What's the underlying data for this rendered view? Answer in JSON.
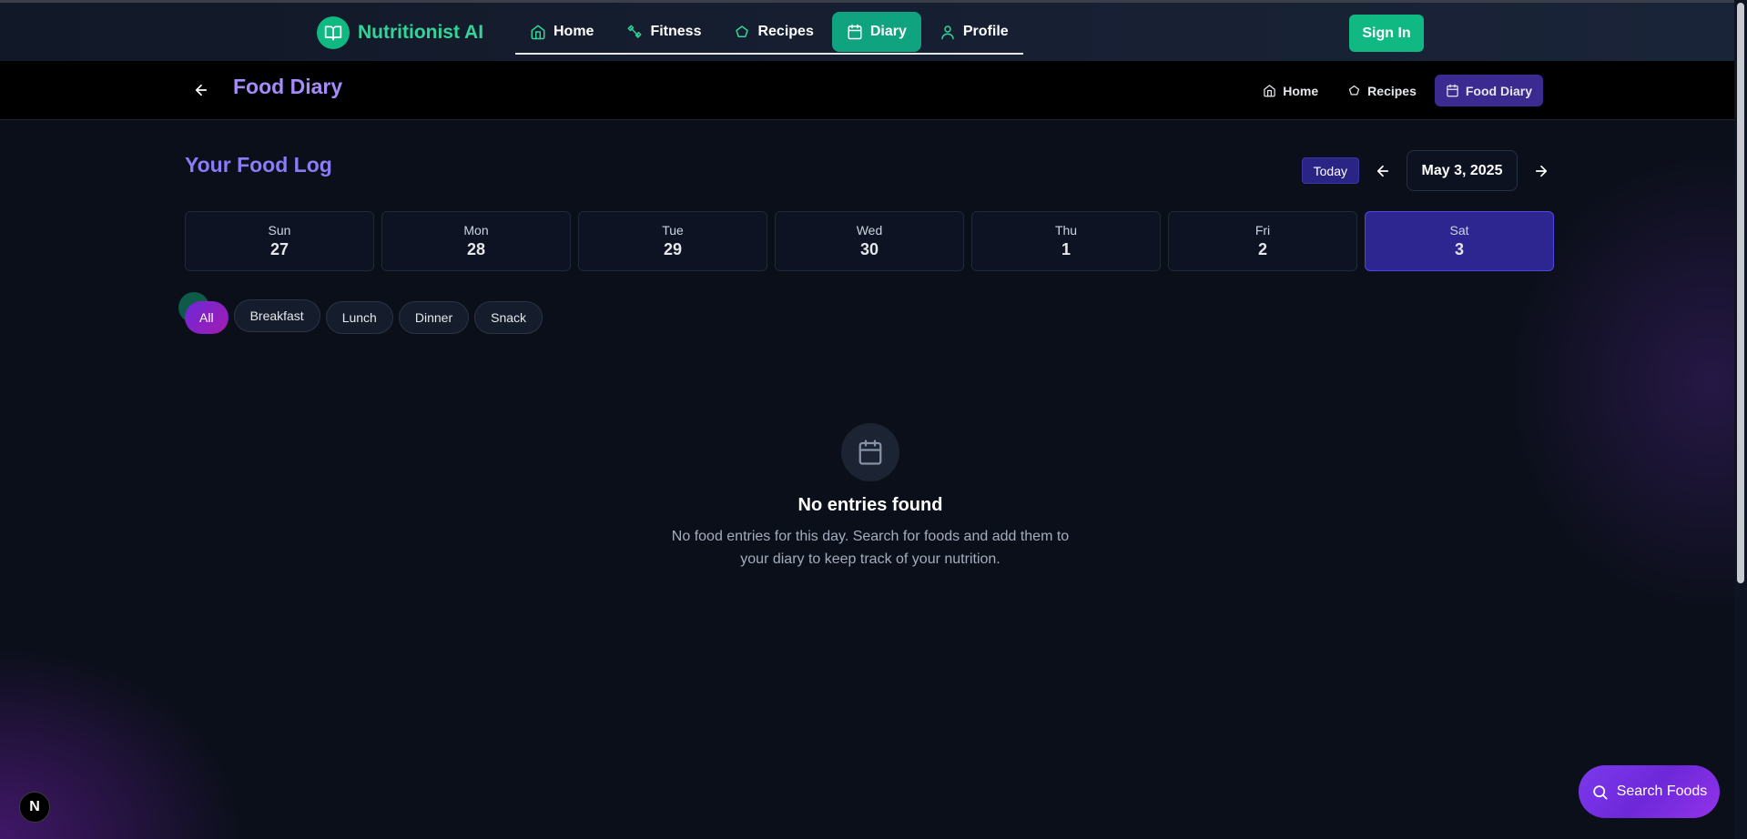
{
  "app": {
    "name": "Nutritionist AI"
  },
  "nav": {
    "tabs": [
      {
        "label": "Home",
        "icon": "home-icon"
      },
      {
        "label": "Fitness",
        "icon": "dumbbell-icon"
      },
      {
        "label": "Recipes",
        "icon": "chef-hat-icon"
      },
      {
        "label": "Diary",
        "icon": "calendar-icon",
        "active": true
      },
      {
        "label": "Profile",
        "icon": "user-icon"
      }
    ],
    "sign_in": "Sign In"
  },
  "subheader": {
    "title": "Food Diary",
    "links": [
      {
        "label": "Home",
        "icon": "home-icon"
      },
      {
        "label": "Recipes",
        "icon": "chef-hat-icon"
      },
      {
        "label": "Food Diary",
        "icon": "calendar-icon",
        "active": true
      }
    ]
  },
  "log": {
    "title": "Your Food Log",
    "today_label": "Today",
    "current_date": "May 3, 2025",
    "days": [
      {
        "name": "Sun",
        "date": "27"
      },
      {
        "name": "Mon",
        "date": "28"
      },
      {
        "name": "Tue",
        "date": "29"
      },
      {
        "name": "Wed",
        "date": "30"
      },
      {
        "name": "Thu",
        "date": "1"
      },
      {
        "name": "Fri",
        "date": "2"
      },
      {
        "name": "Sat",
        "date": "3",
        "active": true
      }
    ],
    "filters": [
      "All",
      "Breakfast",
      "Lunch",
      "Dinner",
      "Snack"
    ],
    "active_filter": "All"
  },
  "empty_state": {
    "title": "No entries found",
    "text": "No food entries for this day. Search for foods and add them to your diary to keep track of your nutrition."
  },
  "fab": {
    "label": "Search Foods"
  },
  "dev_badge": {
    "label": "N"
  },
  "colors": {
    "accent_green": "#10b981",
    "accent_purple": "#7c3aed",
    "background": "#0b0f1a"
  }
}
